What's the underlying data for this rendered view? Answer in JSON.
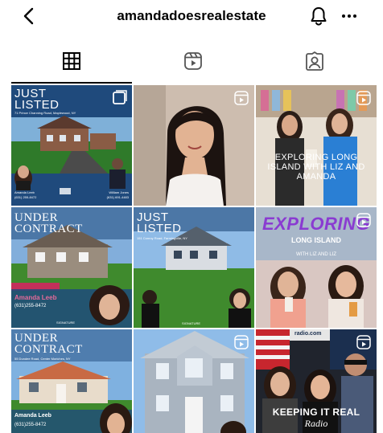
{
  "header": {
    "username": "amandadoesrealestate",
    "back_icon": "chevron-left-icon",
    "notification_icon": "bell-icon",
    "more_icon": "more-horizontal-icon"
  },
  "tabs": [
    {
      "name": "posts-grid",
      "icon": "grid-icon",
      "active": true
    },
    {
      "name": "reels",
      "icon": "reels-icon",
      "active": false
    },
    {
      "name": "tagged",
      "icon": "tagged-person-icon",
      "active": false
    }
  ],
  "posts": {
    "p1": {
      "title_line1": "JUST",
      "title_line2": "LISTED",
      "address": "71 Prince Channing Road, Maplewood, NY",
      "agent1_name": "Amanda Leeb",
      "agent2_name": "William Jones",
      "agent1_contact": "(631) 255-8472",
      "agent2_contact": "(631) 691-4483"
    },
    "p3": {
      "caption_line1": "EXPLORING LONG",
      "caption_line2": "ISLAND WITH LIZ AND",
      "caption_line3": "AMANDA"
    },
    "p4": {
      "title_line1": "UNDER",
      "title_line2": "CONTRACT",
      "agent_name": "Amanda Leeb",
      "phone": "(631)255-8472",
      "brand": "SIGNATURE"
    },
    "p5": {
      "title_line1": "JUST",
      "title_line2": "LISTED",
      "address": "151 Conroy Road, Farmingville, NY",
      "brand": "SIGNATURE"
    },
    "p6": {
      "title": "EXPLORING",
      "subtitle": "LONG ISLAND",
      "tag": "WITH LIZ AND LIZ"
    },
    "p7": {
      "title_line1": "UNDER",
      "title_line2": "CONTRACT",
      "address": "55 Dundee Road, Center Moriches, NY",
      "agent_name": "Amanda Leeb",
      "phone": "(631)255-8472"
    },
    "p9": {
      "url": "radio.com",
      "caption_line1": "KEEPING IT REAL",
      "caption_line2": "Radio"
    }
  },
  "colors": {
    "text": "#000000",
    "listed_blue": "#1f4a7c",
    "exploring_purple": "#8a3bd1",
    "radio_pink": "#e0277a",
    "lawn_green": "#3f8a2d"
  }
}
